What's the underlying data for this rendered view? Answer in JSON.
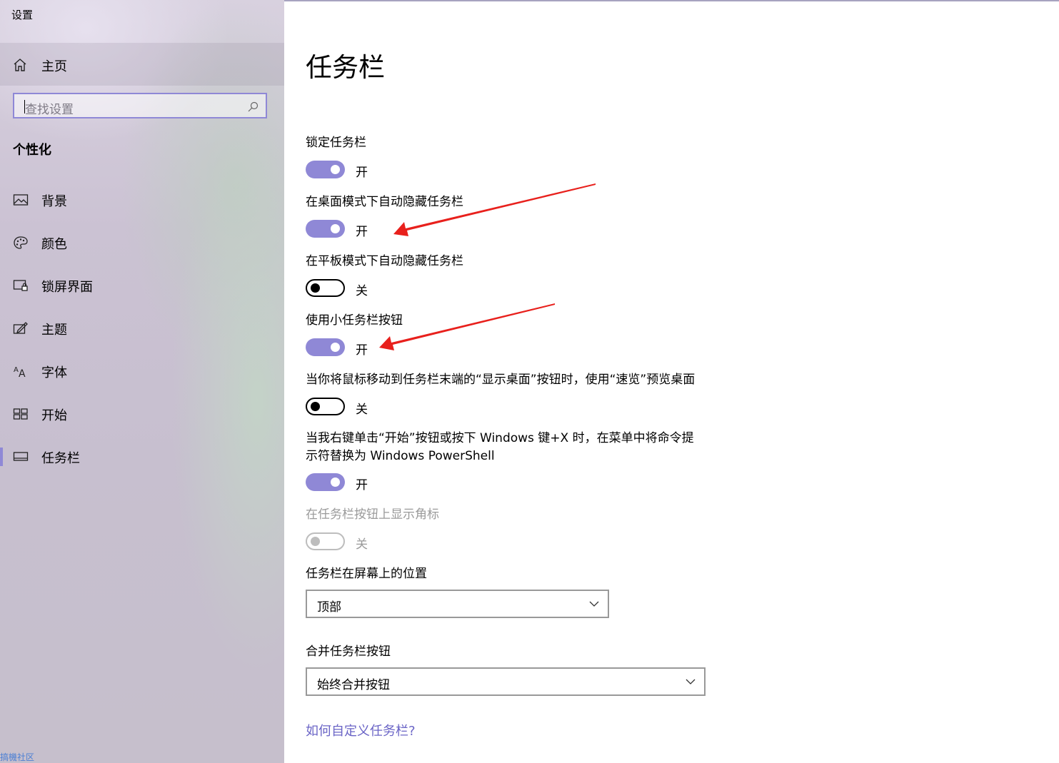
{
  "window": {
    "title": "设置"
  },
  "sidebar": {
    "home_label": "主页",
    "search_placeholder": "查找设置",
    "section_title": "个性化",
    "items": [
      {
        "label": "背景",
        "icon": "picture-icon"
      },
      {
        "label": "颜色",
        "icon": "palette-icon"
      },
      {
        "label": "锁屏界面",
        "icon": "lock-screen-icon"
      },
      {
        "label": "主题",
        "icon": "theme-icon"
      },
      {
        "label": "字体",
        "icon": "font-icon"
      },
      {
        "label": "开始",
        "icon": "start-icon"
      },
      {
        "label": "任务栏",
        "icon": "taskbar-icon",
        "selected": true
      }
    ],
    "watermark": "搞機社区"
  },
  "main": {
    "title": "任务栏",
    "settings": [
      {
        "label": "锁定任务栏",
        "state": "on",
        "state_label": "开"
      },
      {
        "label": "在桌面模式下自动隐藏任务栏",
        "state": "on",
        "state_label": "开"
      },
      {
        "label": "在平板模式下自动隐藏任务栏",
        "state": "off",
        "state_label": "关"
      },
      {
        "label": "使用小任务栏按钮",
        "state": "on",
        "state_label": "开"
      },
      {
        "label": "当你将鼠标移动到任务栏末端的“显示桌面”按钮时，使用“速览”预览桌面",
        "state": "off",
        "state_label": "关"
      },
      {
        "label_line1": "当我右键单击“开始”按钮或按下 Windows 键+X 时，在菜单中将命令提",
        "label_line2": "示符替换为 Windows PowerShell",
        "state": "on",
        "state_label": "开"
      },
      {
        "label": "在任务栏按钮上显示角标",
        "state": "disabled",
        "state_label": "关"
      }
    ],
    "position": {
      "label": "任务栏在屏幕上的位置",
      "value": "顶部"
    },
    "combine": {
      "label": "合并任务栏按钮",
      "value": "始终合并按钮"
    },
    "help_link": "如何自定义任务栏?"
  },
  "colors": {
    "accent": "#8f88d6",
    "annotation_arrow": "#e8201c",
    "link": "#6a64c6"
  }
}
